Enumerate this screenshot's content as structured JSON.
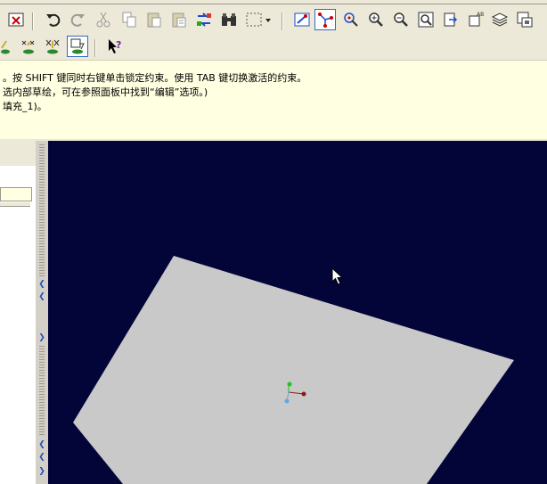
{
  "messages": {
    "line1": "。按 SHIFT 键同时右键单击锁定约束。使用 TAB 键切换激活的约束。",
    "line2": "选内部草绘，可在参照面板中找到“编辑”选项。)",
    "line3": "填充_1)。"
  },
  "toolbar": {
    "row1": [
      "close-window-icon",
      "undo-icon",
      "redo-icon",
      "cut-icon",
      "copy-icon",
      "paste-icon",
      "paste-special-icon",
      "regenerate-icon",
      "find-icon",
      "select-box-icon",
      "dropdown-arrow-icon",
      "display-style-icon",
      "datum-display-icon",
      "spin-center-icon",
      "zoom-in-icon",
      "zoom-out-icon",
      "refit-icon",
      "reorient-icon",
      "saved-views-icon",
      "layers-icon",
      "view-manager-icon"
    ],
    "row2": [
      "constraint-icon",
      "dimension-icon",
      "delete-segment-icon",
      "sketch-view-icon",
      "select-help-icon"
    ]
  },
  "colors": {
    "viewport_bg": "#030438",
    "plane_fill": "#c9c9c9",
    "message_bg": "#ffffe1",
    "axis_x": "#8b1a1a",
    "axis_y": "#22c322",
    "axis_z": "#5fa8e8"
  }
}
